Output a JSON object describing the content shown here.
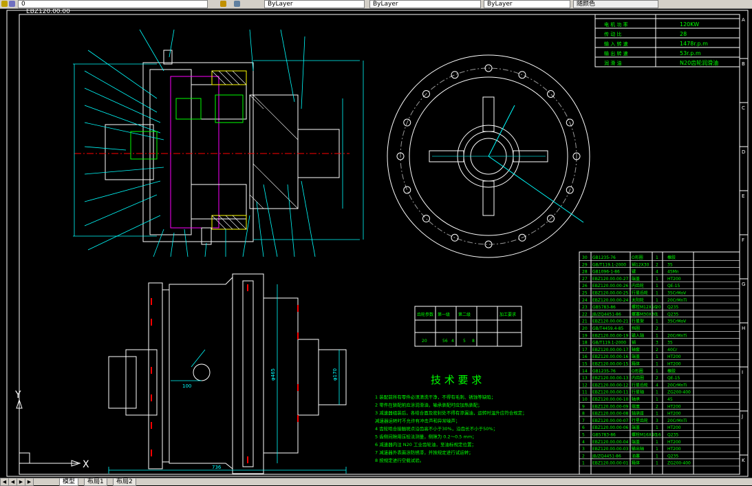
{
  "toolbar": {
    "layer_value": "0",
    "linetype_value": "ByLayer",
    "lineweight_value": "ByLayer",
    "color_value": "ByLayer",
    "plot_style_value": "随颜色"
  },
  "drawing": {
    "partial_title": "EBZ120.00.00",
    "spec_table": [
      {
        "label": "电 机 功 率",
        "value": "120KW"
      },
      {
        "label": "传 动 比",
        "value": "28"
      },
      {
        "label": "输 入 转 速",
        "value": "1478r.p.m"
      },
      {
        "label": "输 出 转 速",
        "value": "53r.p.m"
      },
      {
        "label": "润 滑 油",
        "value": "N20齿轮润滑油"
      }
    ],
    "grid_letters_right": [
      "A",
      "B",
      "C",
      "D",
      "E",
      "F",
      "G",
      "H",
      "I",
      "J",
      "K"
    ],
    "dimensions": {
      "width_736": "736",
      "dim_100": "100",
      "dia_465": "φ465",
      "dia_170": "φ170",
      "dia_132": "φ132",
      "dia_465_side": "φ465"
    },
    "tech_title": "技 术 要 求",
    "tech_notes": [
      "1 装配前所有零件必须清洗干净，不得有毛刺、锈蚀等缺陷；",
      "2 零件在装配前应涂润滑油，轴承装配时应加热装配；",
      "3 减速器组装后，各结合面及密封处不得有渗漏油，运转时温升应符合规定；",
      "  减速器运转时不允许有冲击声和异常噪声；",
      "4 齿轮啮合接触斑点沿齿高不小于30%，沿齿长不小于50%；",
      "5 齿侧间隙用压铅法测量，侧隙为 0.2～0.5 mm；",
      "6 减速器内注 N20 工业齿轮油，至油标规定位置；",
      "7 减速器外表面涂防锈漆，并按规定进行试运转；",
      "8 按规定进行空载试验。"
    ],
    "gear_table": {
      "headers": [
        "齿轮参数",
        "第一级",
        "第二级",
        "",
        "加工要求"
      ],
      "row": [
        "20",
        "56",
        "4",
        "5",
        "8"
      ]
    },
    "bom_rows": [
      {
        "no": "30",
        "code": "GB1235-76",
        "name": "O形圈",
        "qty": "1",
        "mat": "橡胶"
      },
      {
        "no": "29",
        "code": "GB/T119.1-2000",
        "name": "销12X30",
        "qty": "2",
        "mat": "35"
      },
      {
        "no": "28",
        "code": "GB1096-1-86",
        "name": "键",
        "qty": "4",
        "mat": "45Mn"
      },
      {
        "no": "27",
        "code": "EBZ120.00.00-27",
        "name": "端盖",
        "qty": "1",
        "mat": "HT200"
      },
      {
        "no": "26",
        "code": "EBZ120.00.00-26",
        "name": "内齿轮",
        "qty": "1",
        "mat": "QE-15"
      },
      {
        "no": "25",
        "code": "EBZ120.00.00-25",
        "name": "行星齿轮",
        "qty": "1",
        "mat": "35CrMoV"
      },
      {
        "no": "24",
        "code": "EBZ120.00.00-24",
        "name": "太阳轮",
        "qty": "1",
        "mat": "20CrMnTi"
      },
      {
        "no": "23",
        "code": "GB5783-86",
        "name": "螺栓M12X50",
        "qty": "20",
        "mat": "Q235"
      },
      {
        "no": "22",
        "code": "JB/ZQ4451-86",
        "name": "螺塞M30X30",
        "qty": "1",
        "mat": "Q235"
      },
      {
        "no": "21",
        "code": "EBZ120.00.00-21",
        "name": "行星架",
        "qty": "1",
        "mat": "35CrMoV"
      },
      {
        "no": "20",
        "code": "GB/T4459.4-85",
        "name": "挡圈",
        "qty": "2",
        "mat": ""
      },
      {
        "no": "19",
        "code": "EBZ120.00.00-19",
        "name": "输入轴",
        "qty": "1",
        "mat": "20CrMnTi"
      },
      {
        "no": "18",
        "code": "GB/T119.1-2000",
        "name": "销",
        "qty": "3",
        "mat": "35"
      },
      {
        "no": "17",
        "code": "EBZ120.00.00-17",
        "name": "轴套",
        "qty": "2",
        "mat": "40Cr"
      },
      {
        "no": "16",
        "code": "EBZ120.00.00-16",
        "name": "端盖",
        "qty": "1",
        "mat": "HT200"
      },
      {
        "no": "15",
        "code": "EBZ120.00.00-15",
        "name": "箱体",
        "qty": "1",
        "mat": "HT200"
      },
      {
        "no": "14",
        "code": "GB1235-76",
        "name": "O形圈",
        "qty": "1",
        "mat": "橡胶"
      },
      {
        "no": "13",
        "code": "EBZ120.00.00-13",
        "name": "内齿圈",
        "qty": "2",
        "mat": "QE-15"
      },
      {
        "no": "12",
        "code": "EBZ120.00.00-12",
        "name": "行星齿轮",
        "qty": "4",
        "mat": "20CrMnTi"
      },
      {
        "no": "11",
        "code": "EBZ120.00.00-11",
        "name": "行星轴",
        "qty": "1",
        "mat": "ZG200-400"
      },
      {
        "no": "10",
        "code": "EBZ120.00.00-10",
        "name": "轴承",
        "qty": "1",
        "mat": "45"
      },
      {
        "no": "9",
        "code": "EBZ120.00.00-09",
        "name": "端盖",
        "qty": "2",
        "mat": "HT200"
      },
      {
        "no": "8",
        "code": "EBZ120.00.00-08",
        "name": "轴承座",
        "qty": "1",
        "mat": "HT200"
      },
      {
        "no": "7",
        "code": "EBZ120.00.00-07",
        "name": "行星齿轮",
        "qty": "3",
        "mat": "20CrMnTi"
      },
      {
        "no": "6",
        "code": "EBZ120.00.00-06",
        "name": "端盖",
        "qty": "1",
        "mat": "HT200"
      },
      {
        "no": "5",
        "code": "GB5783-86",
        "name": "螺栓M16X40",
        "qty": "16",
        "mat": "Q235"
      },
      {
        "no": "4",
        "code": "EBZ120.00.00-04",
        "name": "端盖",
        "qty": "1",
        "mat": "HT200"
      },
      {
        "no": "3",
        "code": "EBZ120.00.00-03",
        "name": "输出轴",
        "qty": "1",
        "mat": "HT200"
      },
      {
        "no": "2",
        "code": "JB/ZQ4451-86",
        "name": "油塞",
        "qty": "1",
        "mat": "Q235"
      },
      {
        "no": "1",
        "code": "EBZ120.00.00-01",
        "name": "箱体",
        "qty": "1",
        "mat": "ZG200-400"
      }
    ],
    "ucs_label_x": "X",
    "ucs_label_y": "Y"
  },
  "tabs": {
    "model": "模型",
    "layout1": "布局1",
    "layout2": "布局2"
  },
  "colors": {
    "line": "#ffffff",
    "cyan": "#00ffff",
    "green": "#00ff00",
    "red": "#ff0000",
    "magenta": "#ff00ff",
    "yellow": "#ffff00"
  }
}
